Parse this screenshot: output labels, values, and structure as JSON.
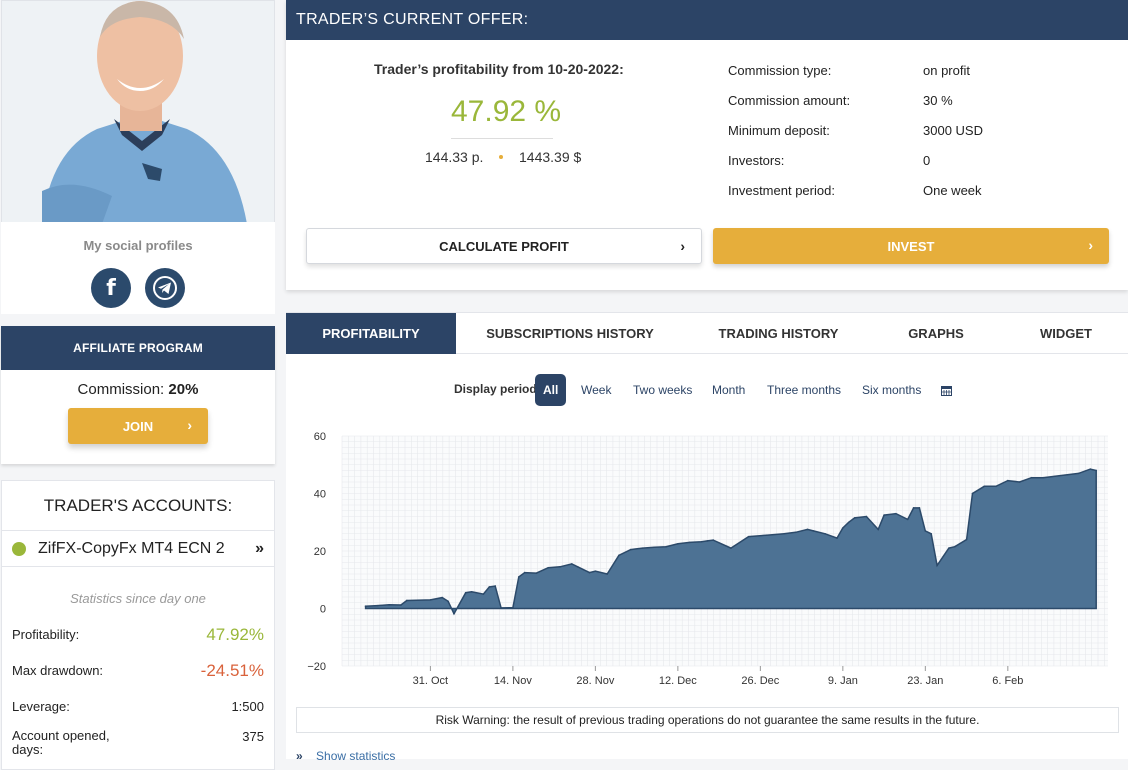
{
  "social": {
    "title": "My social profiles",
    "links": [
      {
        "icon": "facebook-icon",
        "glyph": "f"
      },
      {
        "icon": "telegram-icon"
      }
    ]
  },
  "affiliate": {
    "header": "AFFILIATE PROGRAM",
    "commission_label": "Commission:",
    "commission_value": "20%",
    "join_label": "JOIN",
    "chevron": "›"
  },
  "accounts": {
    "title": "TRADER'S ACCOUNTS:",
    "account_name": "ZifFX-CopyFx MT4 ECN 2",
    "status_color": "#9ab73a",
    "expand_glyph": "»",
    "stats_since": "Statistics since day one",
    "stats": [
      {
        "label": "Profitability:",
        "value": "47.92%",
        "color": "#9ab73a"
      },
      {
        "label": "Max drawdown:",
        "value": "-24.51%",
        "color": "#d9623b"
      },
      {
        "label": "Leverage:",
        "value": "1:500",
        "color": "#222222"
      },
      {
        "label": "Account opened, days:",
        "value": "375",
        "color": "#222222"
      }
    ]
  },
  "offer": {
    "header": "TRADER’S CURRENT OFFER:",
    "profit_title": "Trader’s profitability from 10-20-2022:",
    "profit_value": "47.92 %",
    "points": "144.33 p.",
    "money": "1443.39 $",
    "details": [
      {
        "label": "Commission type:",
        "value": "on profit"
      },
      {
        "label": "Commission amount:",
        "value": "30 %"
      },
      {
        "label": "Minimum deposit:",
        "value": "3000 USD"
      },
      {
        "label": "Investors:",
        "value": "0"
      },
      {
        "label": "Investment period:",
        "value": "One week"
      }
    ],
    "calc_button": "CALCULATE PROFIT",
    "invest_button": "INVEST",
    "chevron": "›"
  },
  "tabs": [
    "PROFITABILITY",
    "SUBSCRIPTIONS HISTORY",
    "TRADING HISTORY",
    "GRAPHS",
    "WIDGET"
  ],
  "active_tab": 0,
  "display_period": {
    "label": "Display period:",
    "options": [
      "All",
      "Week",
      "Two weeks",
      "Month",
      "Three months",
      "Six months"
    ],
    "selected": "All",
    "calendar_icon": "calendar-icon"
  },
  "chart_data": {
    "type": "area",
    "title": "",
    "xlabel": "",
    "ylabel": "",
    "ylim": [
      -20,
      60
    ],
    "yticks": [
      -20,
      0,
      20,
      40,
      60
    ],
    "xticks": [
      "31. Oct",
      "14. Nov",
      "28. Nov",
      "12. Dec",
      "26. Dec",
      "9. Jan",
      "23. Jan",
      "6. Feb"
    ],
    "fill_color": "#4d7294",
    "line_color": "#2c4a6a",
    "grid": true,
    "series": [
      {
        "x": [
          "2022-10-20",
          "2022-10-22",
          "2022-10-24",
          "2022-10-26",
          "2022-10-27",
          "2022-10-31",
          "2022-11-02",
          "2022-11-03",
          "2022-11-04",
          "2022-11-06",
          "2022-11-07",
          "2022-11-09",
          "2022-11-10",
          "2022-11-11",
          "2022-11-12",
          "2022-11-14",
          "2022-11-15",
          "2022-11-16",
          "2022-11-18",
          "2022-11-20",
          "2022-11-22",
          "2022-11-24",
          "2022-11-25",
          "2022-11-27",
          "2022-11-28",
          "2022-11-30",
          "2022-12-02",
          "2022-12-04",
          "2022-12-06",
          "2022-12-08",
          "2022-12-10",
          "2022-12-12",
          "2022-12-14",
          "2022-12-16",
          "2022-12-17",
          "2022-12-18",
          "2022-12-21",
          "2022-12-24",
          "2022-12-27",
          "2022-12-30",
          "2023-01-01",
          "2023-01-03",
          "2023-01-04",
          "2023-01-06",
          "2023-01-08",
          "2023-01-09",
          "2023-01-10",
          "2023-01-11",
          "2023-01-13",
          "2023-01-15",
          "2023-01-16",
          "2023-01-18",
          "2023-01-20",
          "2023-01-21",
          "2023-01-22",
          "2023-01-23",
          "2023-01-24",
          "2023-01-25",
          "2023-01-27",
          "2023-01-28",
          "2023-01-30",
          "2023-01-31",
          "2023-02-02",
          "2023-02-04",
          "2023-02-06",
          "2023-02-08",
          "2023-02-10",
          "2023-02-12",
          "2023-02-14",
          "2023-02-18",
          "2023-02-20",
          "2023-02-21"
        ],
        "y": [
          0.8,
          1.0,
          1.3,
          1.2,
          2.8,
          3.0,
          3.8,
          2.5,
          -1.8,
          5.5,
          5.8,
          5.0,
          7.5,
          7.8,
          0.2,
          0.3,
          11.0,
          12.5,
          12.3,
          14.2,
          14.5,
          15.5,
          14.5,
          12.5,
          13.0,
          12.0,
          18.5,
          20.5,
          21.0,
          21.3,
          21.5,
          22.5,
          23.0,
          23.2,
          23.5,
          23.8,
          21.0,
          25.0,
          25.5,
          26.0,
          26.5,
          27.5,
          27.0,
          26.0,
          24.5,
          28.0,
          30.0,
          31.5,
          32.0,
          27.5,
          32.5,
          33.0,
          31.0,
          35.0,
          35.0,
          27.0,
          26.0,
          15.0,
          21.0,
          21.5,
          24.0,
          40.0,
          42.5,
          42.5,
          44.5,
          44.0,
          45.5,
          45.5,
          46.0,
          47.0,
          48.5,
          48.0
        ]
      }
    ]
  },
  "risk_warning": "Risk Warning: the result of previous trading operations do not guarantee the same results in the future.",
  "show_statistics": {
    "icon": "double-chevron-icon",
    "glyph": "»",
    "label": "Show statistics"
  }
}
